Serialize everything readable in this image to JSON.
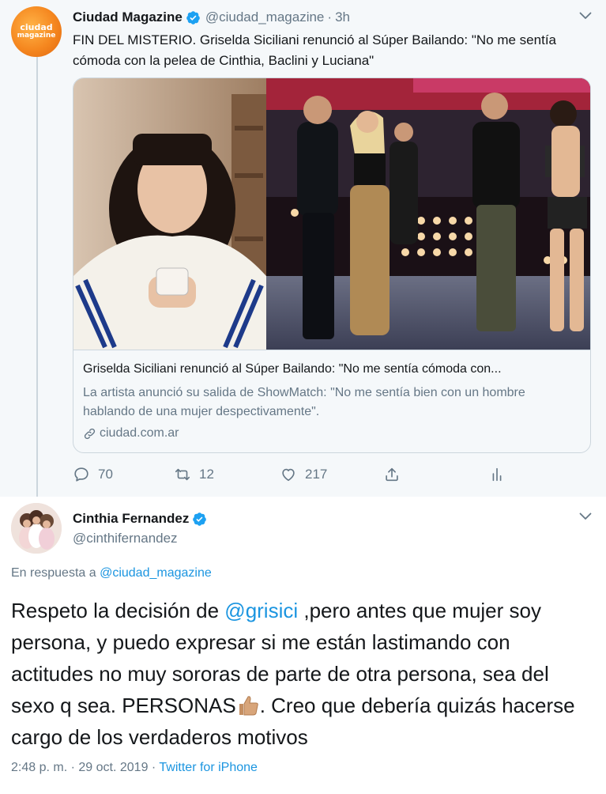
{
  "tweet1": {
    "avatar_line1": "ciudad",
    "avatar_line2": "magazine",
    "name": "Ciudad Magazine",
    "handle": "@ciudad_magazine",
    "separator": "·",
    "time": "3h",
    "text": "FIN DEL MISTERIO. Griselda Siciliani renunció al Súper Bailando: \"No me sentía cómoda con la pelea de Cinthia, Baclini y Luciana\"",
    "card": {
      "title": "Griselda Siciliani renunció al Súper Bailando: \"No me sentía cómoda con...",
      "description": "La artista anunció su salida de ShowMatch: \"No me sentía bien con un hombre hablando de una mujer despectivamente\".",
      "domain": "ciudad.com.ar"
    },
    "actions": {
      "replies": "70",
      "retweets": "12",
      "likes": "217"
    }
  },
  "tweet2": {
    "name": "Cinthia Fernandez",
    "handle": "@cinthifernandez",
    "reply_prefix": "En respuesta a",
    "reply_to": "@ciudad_magazine",
    "text_part1": "Respeto la decisión de ",
    "mention": "@grisici",
    "text_part2": " ,pero antes que mujer soy persona, y puedo expresar si me están lastimando con actitudes no muy sororas de parte de otra persona, sea del sexo q sea. PERSONAS",
    "text_part3": ". Creo que debería quizás hacerse cargo de los verdaderos motivos",
    "time": "2:48 p. m.",
    "separator": "·",
    "date": "29 oct. 2019",
    "source": "Twitter for iPhone"
  },
  "colors": {
    "link": "#1b95e0",
    "muted": "#657786",
    "verified": "#1da1f2",
    "thread_bg": "#f5f8fa"
  },
  "icons": [
    "verified-badge-icon",
    "chevron-down-icon",
    "link-icon",
    "reply-icon",
    "retweet-icon",
    "like-icon",
    "share-icon",
    "analytics-icon",
    "thumbs-up-emoji"
  ]
}
